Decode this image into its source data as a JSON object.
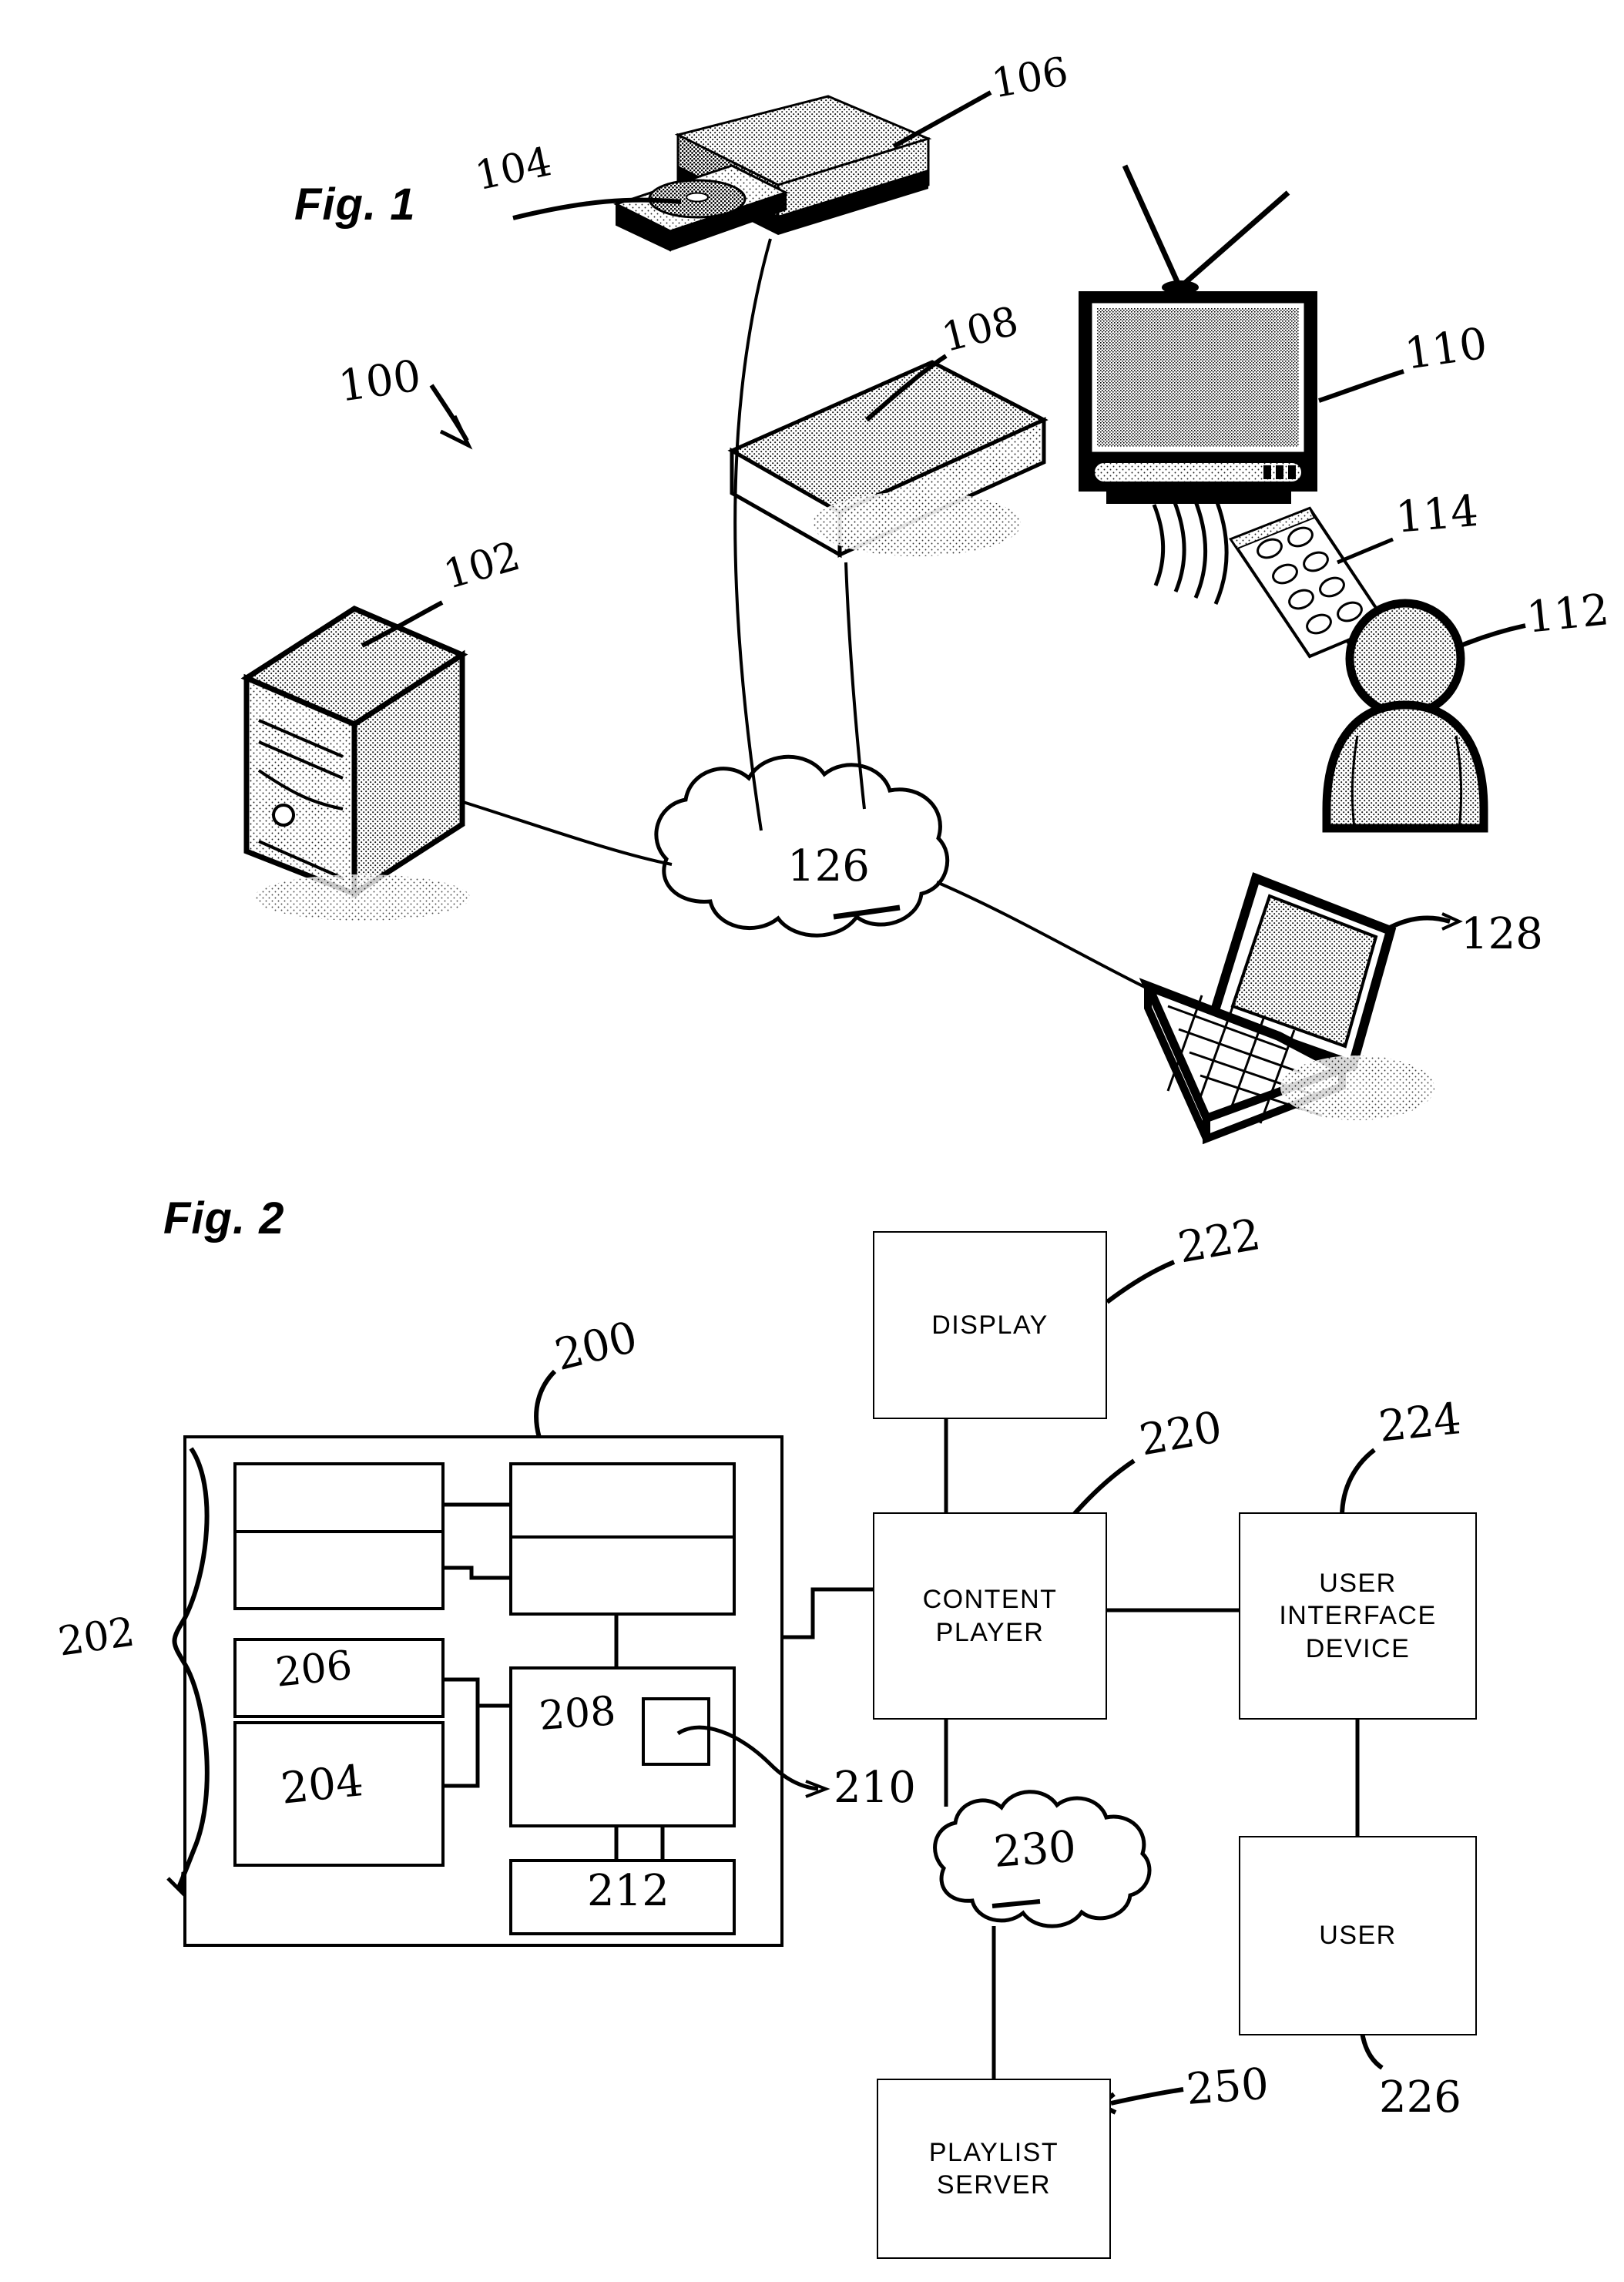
{
  "sheet": {
    "background_color": "#ffffff",
    "ink_color": "#000000"
  },
  "figures": [
    {
      "id": "fig1",
      "title": "Fig. 1",
      "caption_numeral": "100",
      "description": "System-level pictorial diagram of a content distribution system"
    },
    {
      "id": "fig2",
      "title": "Fig. 2",
      "description": "Block diagram of content player, display, user interface device and playlist server"
    }
  ],
  "fig1": {
    "title": "Fig. 1",
    "system_numeral": "100",
    "elements": [
      {
        "numeral": "102",
        "name": "server-tower",
        "description": "Tower server computer"
      },
      {
        "numeral": "104",
        "name": "disc-media",
        "description": "Optical disc in open tray"
      },
      {
        "numeral": "106",
        "name": "disc-player",
        "description": "Optical disc player with open tray"
      },
      {
        "numeral": "108",
        "name": "set-top-box",
        "description": "Set top box"
      },
      {
        "numeral": "110",
        "name": "television",
        "description": "Television with antenna"
      },
      {
        "numeral": "112",
        "name": "user-person",
        "description": "User"
      },
      {
        "numeral": "114",
        "name": "remote-control",
        "description": "Handheld remote control"
      },
      {
        "numeral": "126",
        "name": "network-cloud",
        "description": "Network cloud"
      },
      {
        "numeral": "128",
        "name": "laptop-computer",
        "description": "Laptop computer"
      }
    ]
  },
  "fig2": {
    "title": "Fig. 2",
    "outer_numeral": "200",
    "brace_numeral": "202",
    "inner_blocks": [
      {
        "numeral": "",
        "label": "",
        "name": "block-upper-left"
      },
      {
        "numeral": "",
        "label": "",
        "name": "block-upper-right"
      },
      {
        "numeral": "",
        "label": "",
        "name": "block-middle-left"
      },
      {
        "numeral": "",
        "label": "",
        "name": "block-middle-right"
      },
      {
        "numeral": "206",
        "label": "206",
        "name": "block-206"
      },
      {
        "numeral": "208",
        "label": "208",
        "name": "block-208"
      },
      {
        "numeral": "210",
        "label": "210",
        "name": "block-210"
      },
      {
        "numeral": "204",
        "label": "204",
        "name": "block-204"
      },
      {
        "numeral": "212",
        "label": "212",
        "name": "block-212"
      }
    ],
    "named_blocks": [
      {
        "label": "DISPLAY",
        "numeral": "222",
        "name": "display-block"
      },
      {
        "label": "CONTENT\nPLAYER",
        "line1": "CONTENT",
        "line2": "PLAYER",
        "numeral": "220",
        "name": "content-player-block"
      },
      {
        "label": "USER\nINTERFACE\nDEVICE",
        "line1": "USER",
        "line2": "INTERFACE",
        "line3": "DEVICE",
        "numeral": "224",
        "name": "user-interface-device-block"
      },
      {
        "label": "USER",
        "numeral": "226",
        "name": "user-block"
      },
      {
        "label": "PLAYLIST\nSERVER",
        "line1": "PLAYLIST",
        "line2": "SERVER",
        "numeral": "250",
        "name": "playlist-server-block"
      }
    ],
    "cloud_numeral": "230"
  },
  "labels": {
    "fig1_title": "Fig. 1",
    "fig2_title": "Fig. 2",
    "n100": "100",
    "n102": "102",
    "n104": "104",
    "n106": "106",
    "n108": "108",
    "n110": "110",
    "n112": "112",
    "n114": "114",
    "n126": "126",
    "n128": "128",
    "n200": "200",
    "n202": "202",
    "n204": "204",
    "n206": "206",
    "n208": "208",
    "n210": "210",
    "n212": "212",
    "n220": "220",
    "n222": "222",
    "n224": "224",
    "n226": "226",
    "n230": "230",
    "n250": "250",
    "display": "DISPLAY",
    "content": "CONTENT",
    "player": "PLAYER",
    "user": "USER",
    "interface": "INTERFACE",
    "device": "DEVICE",
    "user2": "USER",
    "playlist": "PLAYLIST",
    "server": "SERVER"
  }
}
